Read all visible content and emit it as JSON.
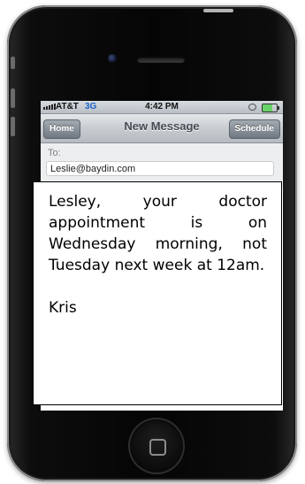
{
  "status_bar": {
    "carrier": "AT&T",
    "network": "3G",
    "time": "4:42 PM"
  },
  "nav_bar": {
    "left_button": "Home",
    "title": "New Message",
    "right_button": "Schedule"
  },
  "compose": {
    "to_label": "To:",
    "to_value": "Leslie@baydin.com"
  },
  "message": {
    "body": "Lesley, your doctor appointment is on Wednesday morning, not Tuesday next week at 12am.",
    "signature": "Kris"
  },
  "icons": {
    "signal": "signal-bars-icon",
    "battery": "battery-icon",
    "home": "home-button-icon"
  }
}
